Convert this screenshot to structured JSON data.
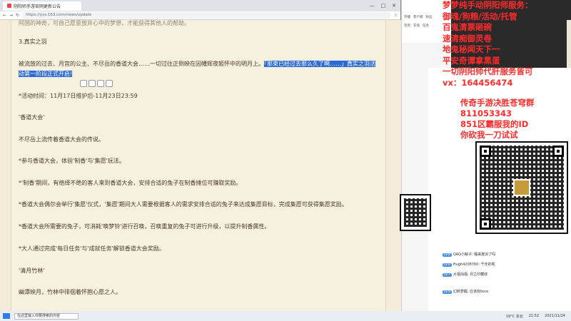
{
  "browser": {
    "tab_title": "阴阳师手游官网更新公告",
    "url": "https://yys.163.com/news/update",
    "window_controls": [
      "—",
      "□",
      "✕"
    ]
  },
  "article": {
    "top_line": "阿国的神奇，可自己愿意放弃心中的梦想，才能获得其他人的帮助。",
    "section_title": "3.真实之羽",
    "para1_a": "被流放的过去、月宫的公主、不尽岳的香道大会……一切过往正倒映在因幡辉夜姬怀中的明月上。",
    "para1_hl": "「那束已经过去那么久了啊……」真实之羽活",
    "para1_b": "动第一阶段正式开启!",
    "time": "*活动时间：11月17日维护后-11月23日23:59",
    "h_xiangdao": "'香道大会'",
    "p_xiangdao": "不尽岳上流传着香道大会的传说。",
    "p_join": "*参与香道大会，体验'制香'与'集愿'玩法。",
    "p_zhixiang": "*'制香'期间，有络绎不绝的客人来到香道大会，安排合适的兔子在制香摊位可赚取奖励。",
    "p_jiyuan": "*香道大会偶尔会举行'集愿'仪式，'集愿'期间大人需要根据客人的需求安排合适的兔子来达成集愿目标，完成集愿可获得集愿奖励。",
    "p_rabbit": "*香道大会所需要的兔子，可消耗'唤梦铃'进行召唤，召唤重复的兔子可进行升级，以提升制香属性。",
    "p_tasks": "*大人通过完成'每日任务'与'成就任务'解锁香道大会奖励。",
    "h_qingyue": "'清月竹林'",
    "p_qingyue": "幽潭映月，竹林中徘徊着怀抱心愿之人。"
  },
  "side": {
    "items": [
      "开播",
      "客户端",
      "粉丝",
      "签到",
      "充值",
      "任务"
    ]
  },
  "chat": {
    "lines": [
      {
        "badge": "LV.8",
        "text": "QAQ小鲸子: 睡来废训了吗"
      },
      {
        "badge": "LV.6",
        "text": "Hugh4208760: 千年的呢"
      },
      {
        "badge": "LV.7",
        "text": "大福灿福: 月之印藏绕"
      },
      {
        "badge": "LV.9",
        "text": "幻醉梦醒: 应该有boss"
      }
    ]
  },
  "ad": {
    "lines": [
      "梦梦纯手动阴阳师服务：",
      "御魂/狗粮/活动/托管",
      "百鬼清票砸碗",
      "速清痴御灵卷",
      "地鬼秘闻天下一",
      "平安奇谭拿黑蛋",
      "一切阴阳师代肝服务皆可",
      "vx：164456474"
    ],
    "lines2": [
      "传奇手游决胜苍穹群",
      "811053343",
      "851区霸服我的ID",
      "你砍我一刀试试"
    ]
  },
  "taskbar": {
    "search_placeholder": "在这里输入你要搜索的内容",
    "clock": "21:52",
    "date": "2021/11/24",
    "weather": "19°C 多云"
  }
}
